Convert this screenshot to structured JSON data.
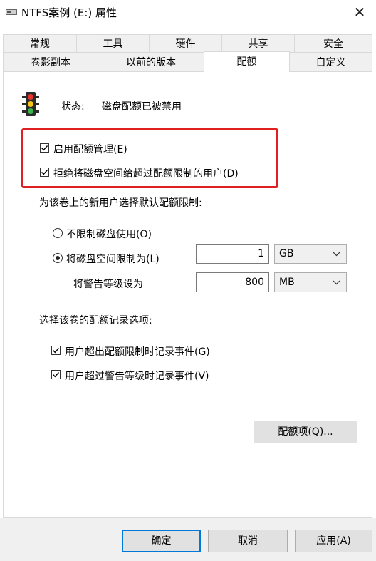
{
  "window": {
    "title": "NTFS案例 (E:) 属性",
    "close_glyph": "✕"
  },
  "tabs_row1": [
    "常规",
    "工具",
    "硬件",
    "共享",
    "安全"
  ],
  "tabs_row2": [
    "卷影副本",
    "以前的版本",
    "配额",
    "自定义"
  ],
  "status": {
    "label": "状态:",
    "value": "磁盘配额已被禁用"
  },
  "options": {
    "enable_quota": {
      "label": "启用配额管理(E)",
      "checked": true
    },
    "deny_space": {
      "label": "拒绝将磁盘空间给超过配额限制的用户(D)",
      "checked": true
    }
  },
  "default_limit_heading": "为该卷上的新用户选择默认配额限制:",
  "no_limit": {
    "label": "不限制磁盘使用(O)",
    "selected": false
  },
  "limit_to": {
    "label": "将磁盘空间限制为(L)",
    "selected": true,
    "value": "1",
    "unit": "GB"
  },
  "warning_level": {
    "label": "将警告等级设为",
    "value": "800",
    "unit": "MB"
  },
  "logging_heading": "选择该卷的配额记录选项:",
  "log_limit": {
    "label": "用户超出配额限制时记录事件(G)",
    "checked": true
  },
  "log_warning": {
    "label": "用户超过警告等级时记录事件(V)",
    "checked": true
  },
  "quota_entries_button": "配额项(Q)...",
  "buttons": {
    "ok": "确定",
    "cancel": "取消",
    "apply": "应用(A)"
  },
  "colors": {
    "highlight": "#e02020",
    "accent": "#0078d7"
  }
}
